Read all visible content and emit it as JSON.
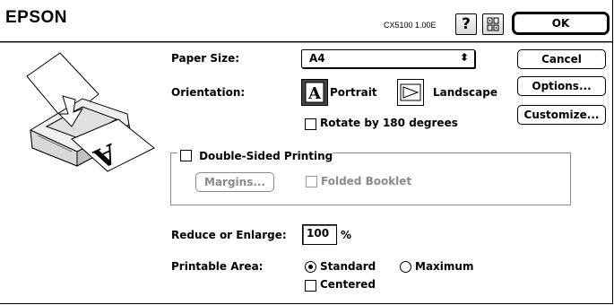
{
  "header": {
    "brand": "EPSON",
    "version": "CX5100 1.00E"
  },
  "buttons": {
    "ok": "OK",
    "cancel": "Cancel",
    "options": "Options...",
    "customize": "Customize..."
  },
  "paper_size": {
    "label": "Paper Size:",
    "value": "A4"
  },
  "orientation": {
    "label": "Orientation:",
    "portrait": "Portrait",
    "landscape": "Landscape",
    "selected": "Portrait",
    "rotate_label": "Rotate by 180 degrees",
    "rotate_checked": false
  },
  "double_sided": {
    "label": "Double-Sided Printing",
    "checked": false,
    "margins_label": "Margins...",
    "folded_booklet_label": "Folded Booklet",
    "folded_booklet_checked": false
  },
  "reduce_enlarge": {
    "label": "Reduce or Enlarge:",
    "value": "100",
    "unit": "%"
  },
  "printable_area": {
    "label": "Printable Area:",
    "standard": "Standard",
    "maximum": "Maximum",
    "selected": "Standard",
    "centered_label": "Centered",
    "centered_checked": false
  }
}
